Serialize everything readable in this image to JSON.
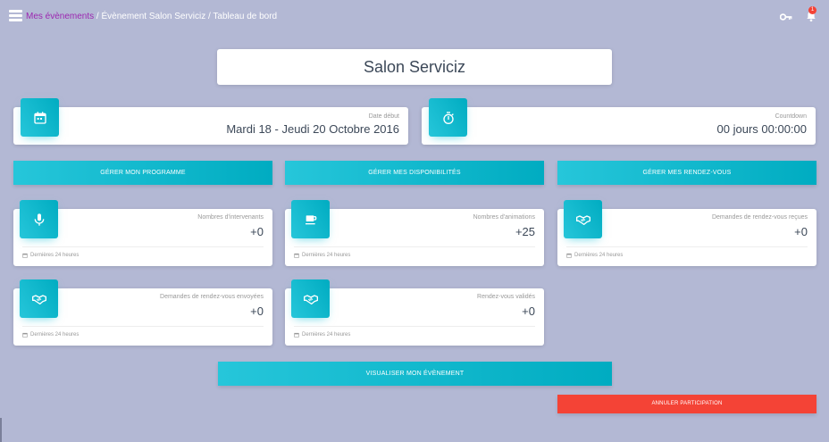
{
  "breadcrumb": {
    "link": "Mes évènements",
    "sep1": " / ",
    "item2": "Évènement Salon Serviciz",
    "sep2": " / ",
    "item3": "Tableau de bord"
  },
  "notifications": {
    "badge": "1"
  },
  "icons": {
    "menu": "hamburger-icon",
    "key": "key-icon",
    "bell": "bell-icon",
    "calendar": "calendar-icon",
    "timer": "timer-icon",
    "mic": "microphone-icon",
    "coffee": "coffee-icon",
    "handshake": "handshake-icon"
  },
  "colors": {
    "background": "#b3b8d4",
    "accent": "#00bcd4",
    "breadcrumb_link": "#9c27b0",
    "danger": "#f44336",
    "badge": "#f44336"
  },
  "event": {
    "title": "Salon Serviciz"
  },
  "date_card": {
    "category": "Date début",
    "value": "Mardi 18 - Jeudi 20 Octobre 2016"
  },
  "countdown_card": {
    "category": "Countdown",
    "value": "00 jours 00:00:00"
  },
  "actions": {
    "programme": "GÉRER MON PROGRAMME",
    "disponibilites": "GÉRER MES DISPONIBILITÉS",
    "rendezvous": "GÉRER MES RENDEZ-VOUS",
    "visualiser": "VISUALISER MON ÉVÈNEMENT",
    "annuler": "ANNULER PARTICIPATION"
  },
  "stats": [
    {
      "category": "Nombres d'intervenants",
      "value": "+0",
      "footer": "Dernières 24 heures",
      "icon": "microphone-icon"
    },
    {
      "category": "Nombres d'animations",
      "value": "+25",
      "footer": "Dernières 24 heures",
      "icon": "coffee-icon"
    },
    {
      "category": "Demandes de rendez-vous reçues",
      "value": "+0",
      "footer": "Dernières 24 heures",
      "icon": "handshake-icon"
    },
    {
      "category": "Demandes de rendez-vous envoyées",
      "value": "+0",
      "footer": "Dernières 24 heures",
      "icon": "handshake-icon"
    },
    {
      "category": "Rendez-vous validés",
      "value": "+0",
      "footer": "Dernières 24 heures",
      "icon": "handshake-icon"
    }
  ]
}
